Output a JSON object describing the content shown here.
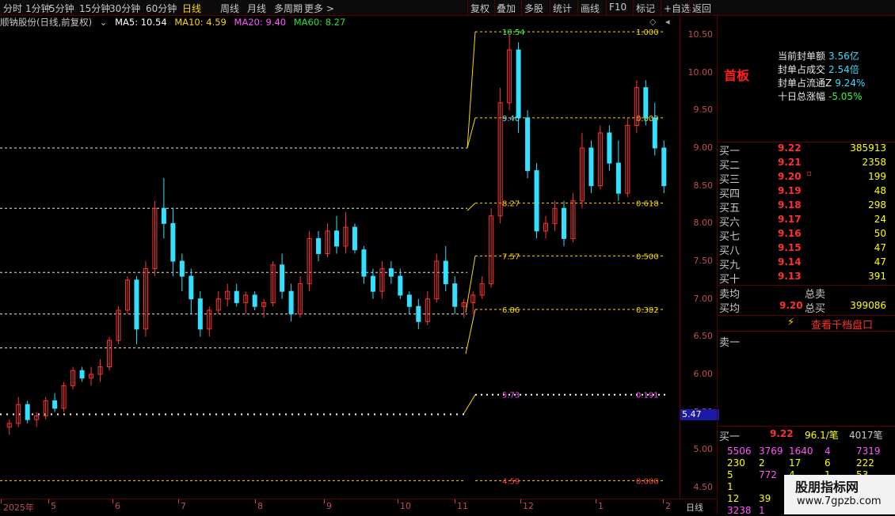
{
  "toolbar": {
    "left_items": [
      "分时",
      "1分钟",
      "5分钟",
      "15分钟",
      "30分钟",
      "60分钟",
      "日线",
      "周线",
      "月线",
      "多周期",
      "更多 >"
    ],
    "right_items": [
      "复权",
      "叠加",
      "多股",
      "统计",
      "画线",
      "F10",
      "标记",
      "+自选",
      "返回"
    ],
    "active": "日线"
  },
  "info": {
    "stock": "顺钠股份(日线,前复权)",
    "ma5": "MA5: 10.54",
    "ma10": "MA10: 4.59",
    "ma20": "MA20: 9.40",
    "ma60": "MA60: 8.27"
  },
  "colors": {
    "up": "#ff3333",
    "down": "#33e0ff",
    "ma_yellow": "#ffd700",
    "grid_red": "#c00000",
    "accent": "#ffd700"
  },
  "chart_data": {
    "type": "candlestick",
    "ylim": [
      4.35,
      10.75
    ],
    "yticks": [
      "10.50",
      "10.00",
      "9.50",
      "9.00",
      "8.50",
      "8.00",
      "7.50",
      "7.00",
      "6.50",
      "6.00",
      "5.50",
      "5.00",
      "4.50"
    ],
    "price_marker": "5.47",
    "x_labels": [
      "2025年",
      "5",
      "6",
      "7",
      "8",
      "9",
      "10",
      "11",
      "12",
      "1",
      "2"
    ],
    "period_label": "日线",
    "fib_levels": [
      {
        "price": 10.54,
        "label": "10.54",
        "ratio": "1.000"
      },
      {
        "price": 9.4,
        "label": "9.40",
        "ratio": "0.809"
      },
      {
        "price": 8.27,
        "label": "8.27",
        "ratio": "0.618"
      },
      {
        "price": 7.57,
        "label": "7.57",
        "ratio": "0.500"
      },
      {
        "price": 6.86,
        "label": "6.86",
        "ratio": "0.382"
      },
      {
        "price": 5.73,
        "label": "5.73",
        "ratio": "0.191"
      },
      {
        "price": 4.59,
        "label": "4.59",
        "ratio": "0.000"
      }
    ],
    "candles": [
      [
        5.3,
        5.4,
        5.2,
        5.35
      ],
      [
        5.35,
        5.7,
        5.3,
        5.6
      ],
      [
        5.6,
        5.65,
        5.35,
        5.4
      ],
      [
        5.4,
        5.5,
        5.3,
        5.45
      ],
      [
        5.45,
        5.7,
        5.4,
        5.65
      ],
      [
        5.65,
        5.75,
        5.5,
        5.55
      ],
      [
        5.55,
        5.9,
        5.5,
        5.85
      ],
      [
        5.85,
        6.1,
        5.8,
        6.05
      ],
      [
        6.05,
        6.1,
        5.9,
        5.95
      ],
      [
        5.95,
        6.1,
        5.85,
        6.0
      ],
      [
        6.0,
        6.2,
        5.9,
        6.1
      ],
      [
        6.1,
        6.5,
        6.05,
        6.45
      ],
      [
        6.45,
        6.9,
        6.4,
        6.85
      ],
      [
        6.85,
        7.3,
        6.8,
        7.25
      ],
      [
        7.25,
        7.3,
        6.4,
        6.6
      ],
      [
        6.6,
        7.5,
        6.5,
        7.4
      ],
      [
        7.4,
        8.3,
        7.3,
        8.2
      ],
      [
        8.2,
        8.6,
        7.8,
        8.0
      ],
      [
        8.0,
        8.2,
        7.3,
        7.5
      ],
      [
        7.5,
        7.6,
        7.1,
        7.3
      ],
      [
        7.3,
        7.4,
        6.8,
        7.0
      ],
      [
        7.0,
        7.1,
        6.5,
        6.6
      ],
      [
        6.6,
        6.9,
        6.5,
        6.85
      ],
      [
        6.85,
        7.1,
        6.8,
        7.0
      ],
      [
        7.0,
        7.2,
        6.9,
        7.1
      ],
      [
        7.1,
        7.2,
        6.9,
        6.95
      ],
      [
        6.95,
        7.1,
        6.8,
        7.05
      ],
      [
        7.05,
        7.1,
        6.85,
        6.9
      ],
      [
        6.9,
        7.0,
        6.75,
        6.95
      ],
      [
        6.95,
        7.5,
        6.9,
        7.45
      ],
      [
        7.45,
        7.6,
        7.0,
        7.1
      ],
      [
        7.1,
        7.2,
        6.7,
        6.8
      ],
      [
        6.8,
        7.3,
        6.75,
        7.2
      ],
      [
        7.2,
        7.9,
        7.1,
        7.8
      ],
      [
        7.8,
        7.9,
        7.5,
        7.6
      ],
      [
        7.6,
        8.0,
        7.55,
        7.9
      ],
      [
        7.9,
        8.1,
        7.6,
        7.7
      ],
      [
        7.7,
        8.15,
        7.6,
        7.95
      ],
      [
        7.95,
        8.0,
        7.6,
        7.65
      ],
      [
        7.65,
        7.7,
        7.2,
        7.3
      ],
      [
        7.3,
        7.4,
        7.0,
        7.1
      ],
      [
        7.1,
        7.5,
        7.0,
        7.4
      ],
      [
        7.4,
        7.5,
        7.2,
        7.3
      ],
      [
        7.3,
        7.4,
        7.0,
        7.05
      ],
      [
        7.05,
        7.1,
        6.8,
        6.9
      ],
      [
        6.9,
        7.0,
        6.6,
        6.7
      ],
      [
        6.7,
        7.1,
        6.65,
        7.0
      ],
      [
        7.0,
        7.6,
        6.95,
        7.5
      ],
      [
        7.5,
        7.7,
        7.1,
        7.2
      ],
      [
        7.2,
        7.3,
        6.8,
        6.9
      ],
      [
        6.9,
        7.0,
        6.75,
        6.95
      ],
      [
        6.95,
        7.1,
        6.8,
        7.05
      ],
      [
        7.05,
        7.3,
        7.0,
        7.2
      ],
      [
        7.2,
        8.2,
        7.15,
        8.1
      ],
      [
        8.1,
        9.8,
        8.0,
        9.6
      ],
      [
        9.6,
        10.5,
        9.5,
        10.3
      ],
      [
        10.3,
        10.4,
        9.2,
        9.4
      ],
      [
        9.4,
        9.5,
        8.6,
        8.7
      ],
      [
        8.7,
        8.8,
        7.8,
        7.9
      ],
      [
        7.9,
        8.1,
        7.8,
        8.0
      ],
      [
        8.0,
        8.3,
        7.9,
        8.2
      ],
      [
        8.2,
        8.3,
        7.7,
        7.8
      ],
      [
        7.8,
        8.4,
        7.75,
        8.3
      ],
      [
        8.3,
        9.2,
        8.2,
        9.0
      ],
      [
        9.0,
        9.1,
        8.4,
        8.5
      ],
      [
        8.5,
        9.3,
        8.45,
        9.2
      ],
      [
        9.2,
        9.3,
        8.7,
        8.8
      ],
      [
        8.8,
        9.1,
        8.3,
        8.4
      ],
      [
        8.4,
        9.4,
        8.35,
        9.3
      ],
      [
        9.3,
        9.9,
        9.2,
        9.8
      ],
      [
        9.8,
        9.9,
        9.3,
        9.4
      ],
      [
        9.4,
        9.6,
        8.9,
        9.0
      ],
      [
        9.0,
        9.1,
        8.4,
        8.5
      ]
    ]
  },
  "limit_info": {
    "title": "首板",
    "rows": [
      {
        "label": "当前封单额",
        "value": "3.56亿"
      },
      {
        "label": "封单占成交",
        "value": "2.54倍"
      },
      {
        "label": "封单占流通Z",
        "value": "9.24%"
      },
      {
        "label": "十日总涨幅",
        "value": "-5.05%"
      }
    ]
  },
  "bids": [
    {
      "label": "买一",
      "price": "9.22",
      "vol": "385913"
    },
    {
      "label": "买二",
      "price": "9.21",
      "vol": "2358"
    },
    {
      "label": "买三",
      "price": "9.20",
      "vol": "199"
    },
    {
      "label": "买四",
      "price": "9.19",
      "vol": "48"
    },
    {
      "label": "买五",
      "price": "9.18",
      "vol": "298"
    },
    {
      "label": "买六",
      "price": "9.17",
      "vol": "24"
    },
    {
      "label": "买七",
      "price": "9.16",
      "vol": "50"
    },
    {
      "label": "买八",
      "price": "9.15",
      "vol": "47"
    },
    {
      "label": "买九",
      "price": "9.14",
      "vol": "47"
    },
    {
      "label": "买十",
      "price": "9.13",
      "vol": "391"
    }
  ],
  "avg": {
    "sell_avg": "卖均",
    "total_sell": "总卖",
    "buy_avg": "买均",
    "buy_avg_price": "9.20",
    "total_buy": "总买",
    "total_buy_vol": "399086"
  },
  "panel_button": "查看千档盘口",
  "ask1_label": "卖一",
  "bottom_row": {
    "label": "买一",
    "price": "9.22",
    "amount": "96.1/笔",
    "count": "4017笔"
  },
  "queue": [
    [
      "5506",
      "3769",
      "1640",
      "4",
      "7319"
    ],
    [
      "230",
      "2",
      "17",
      "6",
      "222"
    ],
    [
      "5",
      "772",
      "4",
      "1",
      "53"
    ],
    [
      "1",
      "",
      "",
      "",
      ""
    ],
    [
      "12",
      "39",
      "",
      "",
      ""
    ],
    [
      "3238",
      "1",
      "",
      "",
      ""
    ]
  ],
  "watermark": {
    "line1": "股朋指标网",
    "line2": "www.7gpzb.com"
  }
}
